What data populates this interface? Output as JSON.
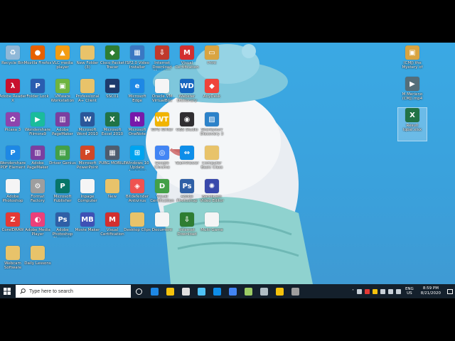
{
  "desktop_icons": [
    {
      "label": "Recycle Bin",
      "icon": "recycle-bin-icon",
      "color": "#8fb8d8",
      "glyph": "♻"
    },
    {
      "label": "Mozilla Firefox",
      "icon": "firefox-icon",
      "color": "#e66000",
      "glyph": "●"
    },
    {
      "label": "VLC media player",
      "icon": "vlc-icon",
      "color": "#f39c12",
      "glyph": "▲"
    },
    {
      "label": "New Folder (3)",
      "icon": "folder-icon",
      "color": "#e8c36a",
      "glyph": ""
    },
    {
      "label": "Cisco Packet Tracer",
      "icon": "packet-tracer-icon",
      "color": "#2e7d32",
      "glyph": "◆"
    },
    {
      "label": "ISP2.0 Video Installer",
      "icon": "installer-icon",
      "color": "#3a78c3",
      "glyph": "▦"
    },
    {
      "label": "Internet Download Manager",
      "icon": "idm-icon",
      "color": "#c0392b",
      "glyph": "⇩"
    },
    {
      "label": "Visual Certification",
      "icon": "visual-cert-icon",
      "color": "#d32f2f",
      "glyph": "M"
    },
    {
      "label": "Print",
      "icon": "print-icon",
      "color": "#d9a441",
      "glyph": "▭"
    },
    {
      "label": "Adobe Reader X",
      "icon": "adobe-reader-icon",
      "color": "#c8102e",
      "glyph": "λ"
    },
    {
      "label": "Folder Lock",
      "icon": "folder-lock-icon",
      "color": "#2a5db0",
      "glyph": "P"
    },
    {
      "label": "VMware Workstation",
      "icon": "vmware-icon",
      "color": "#6fb43f",
      "glyph": "▣"
    },
    {
      "label": "Professional A+ Client",
      "icon": "folder-icon",
      "color": "#e8c36a",
      "glyph": ""
    },
    {
      "label": "SSC01",
      "icon": "ssc-icon",
      "color": "#1e3a6d",
      "glyph": "▬"
    },
    {
      "label": "Microsoft Edge",
      "icon": "edge-icon",
      "color": "#1e88e5",
      "glyph": "e"
    },
    {
      "label": "Oracle VM VirtualBox",
      "icon": "document-icon",
      "color": "#f5f5f5",
      "glyph": ""
    },
    {
      "label": "Webster Dictionary",
      "icon": "webster-icon",
      "color": "#1565c0",
      "glyph": "WD"
    },
    {
      "label": "AnyDesk",
      "icon": "anydesk-icon",
      "color": "#ef443b",
      "glyph": "◆"
    },
    {
      "label": "Picasa 3",
      "icon": "picasa-icon",
      "color": "#8e44ad",
      "glyph": "✿"
    },
    {
      "label": "Wondershare Filmora9",
      "icon": "filmora-icon",
      "color": "#1abc9c",
      "glyph": "▶"
    },
    {
      "label": "Adobe PageMaker",
      "icon": "pagemaker-icon",
      "color": "#7b3fa0",
      "glyph": "▥"
    },
    {
      "label": "Microsoft Word 2010",
      "icon": "word-icon",
      "color": "#2b579a",
      "glyph": "W"
    },
    {
      "label": "Microsoft Excel 2010",
      "icon": "excel-icon",
      "color": "#217346",
      "glyph": "X"
    },
    {
      "label": "Microsoft OneNote",
      "icon": "onenote-icon",
      "color": "#7719aa",
      "glyph": "N"
    },
    {
      "label": "WPS Writer",
      "icon": "wps-icon",
      "color": "#f1b400",
      "glyph": "WT"
    },
    {
      "label": "OBS Studio",
      "icon": "obs-icon",
      "color": "#302e31",
      "glyph": "◉"
    },
    {
      "label": "Shareyourr Discovery 3",
      "icon": "discovery-icon",
      "color": "#2c82c9",
      "glyph": "▨"
    },
    {
      "label": "Wondershare PDF Element",
      "icon": "pdfelement-icon",
      "color": "#1e88e5",
      "glyph": "P"
    },
    {
      "label": "Adobe PageMaker",
      "icon": "pagemaker-icon",
      "color": "#7b3fa0",
      "glyph": "▥"
    },
    {
      "label": "Driver Genius",
      "icon": "driver-genius-icon",
      "color": "#43a047",
      "glyph": "▤"
    },
    {
      "label": "Microsoft PowerPoint",
      "icon": "powerpoint-icon",
      "color": "#d24726",
      "glyph": "P"
    },
    {
      "label": "PUBG MOBILE",
      "icon": "pubg-icon",
      "color": "#4e5c6e",
      "glyph": "▦"
    },
    {
      "label": "Windows 10 Update Assistant",
      "icon": "windows-update-icon",
      "color": "#00a4ef",
      "glyph": "⊞"
    },
    {
      "label": "Google Chrome",
      "icon": "chrome-icon",
      "color": "#4285f4",
      "glyph": "◎"
    },
    {
      "label": "TeamViewer",
      "icon": "teamviewer-icon",
      "color": "#0e8ee9",
      "glyph": "⇔"
    },
    {
      "label": "Computer Basic Class",
      "icon": "folder-icon",
      "color": "#e8c36a",
      "glyph": ""
    },
    {
      "label": "Adobe Photoshop",
      "icon": "document-icon",
      "color": "#f5f5f5",
      "glyph": ""
    },
    {
      "label": "Format Factory",
      "icon": "format-factory-icon",
      "color": "#9e9e9e",
      "glyph": "⚙"
    },
    {
      "label": "Microsoft Publisher",
      "icon": "publisher-icon",
      "color": "#077568",
      "glyph": "P"
    },
    {
      "label": "Inpage Computer",
      "icon": "document-icon",
      "color": "#f5f5f5",
      "glyph": ""
    },
    {
      "label": "New",
      "icon": "folder-icon",
      "color": "#e8c36a",
      "glyph": ""
    },
    {
      "label": "Bitdefender Antivirus",
      "icon": "bitdefender-icon",
      "color": "#ef5350",
      "glyph": "◈"
    },
    {
      "label": "Visual Certification",
      "icon": "visual-cert-green-icon",
      "color": "#43a047",
      "glyph": "D"
    },
    {
      "label": "Adobe Photoshop",
      "icon": "photoshop-icon",
      "color": "#2f5fa6",
      "glyph": "Ps"
    },
    {
      "label": "Bandicam Video Editor",
      "icon": "video-editor-icon",
      "color": "#3949ab",
      "glyph": "✺"
    },
    {
      "label": "CorelDRAW",
      "icon": "coreldraw-icon",
      "color": "#e53935",
      "glyph": "Z"
    },
    {
      "label": "Adobe Media Player",
      "icon": "media-player-icon",
      "color": "#ec407a",
      "glyph": "◐"
    },
    {
      "label": "Adobe Photoshop Elements",
      "icon": "photoshop-icon",
      "color": "#2f5fa6",
      "glyph": "Ps"
    },
    {
      "label": "Movie Maker",
      "icon": "moviemaker-icon",
      "color": "#3f51b5",
      "glyph": "MB"
    },
    {
      "label": "Visual Certification",
      "icon": "visual-cert-icon",
      "color": "#d32f2f",
      "glyph": "M"
    },
    {
      "label": "Desktop Clips",
      "icon": "folder-icon",
      "color": "#e8c36a",
      "glyph": ""
    },
    {
      "label": "Document",
      "icon": "document-icon",
      "color": "#f5f5f5",
      "glyph": ""
    },
    {
      "label": "Internet Download",
      "icon": "download-icon",
      "color": "#2e7d32",
      "glyph": "⇩"
    },
    {
      "label": "Multi Game",
      "icon": "document-icon",
      "color": "#f5f5f5",
      "glyph": ""
    },
    {
      "label": "Webcam Software",
      "icon": "folder-icon",
      "color": "#e8c36a",
      "glyph": ""
    },
    {
      "label": "Daily Lessons",
      "icon": "folder-icon",
      "color": "#e8c36a",
      "glyph": ""
    },
    {
      "label": "(CMJ) the Mystery of",
      "icon": "media-file-icon",
      "color": "#d9a441",
      "glyph": "▣"
    },
    {
      "label": "M Merieno (CMJ).mp4",
      "icon": "video-file-icon",
      "color": "#546e7a",
      "glyph": "▶"
    },
    {
      "label": "Result Iqbal.xlsx",
      "icon": "excel-file-icon",
      "color": "#217346",
      "glyph": "X"
    }
  ],
  "taskbar": {
    "search_placeholder": "Type here to search",
    "apps": [
      {
        "name": "task-view-icon",
        "color": "#ffffff"
      },
      {
        "name": "edge-icon",
        "color": "#1e88e5"
      },
      {
        "name": "store-icon",
        "color": "#f4c20d"
      },
      {
        "name": "mail-icon",
        "color": "#e0e0e0"
      },
      {
        "name": "network-icon",
        "color": "#4fc3f7"
      },
      {
        "name": "teamviewer-icon",
        "color": "#0e8ee9"
      },
      {
        "name": "chrome-icon",
        "color": "#4285f4"
      },
      {
        "name": "packet-tracer-icon",
        "color": "#9ccc65"
      },
      {
        "name": "tool-icon",
        "color": "#b0bec5"
      },
      {
        "name": "file-explorer-icon",
        "color": "#f4c20d"
      },
      {
        "name": "obs-icon",
        "color": "#9e9e9e"
      }
    ],
    "lang_line1": "ENG",
    "lang_line2": "US",
    "time": "8:59 PM",
    "date": "8/21/2020"
  }
}
